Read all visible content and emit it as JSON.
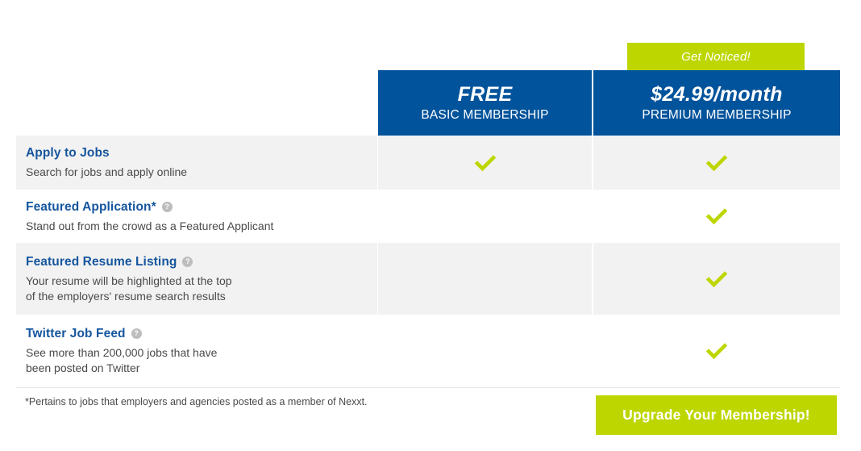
{
  "promo": {
    "label": "Get Noticed!",
    "color": "#bed600"
  },
  "plans": {
    "free": {
      "price": "FREE",
      "name": "BASIC MEMBERSHIP",
      "header_color": "#01539b"
    },
    "premium": {
      "price": "$24.99/month",
      "name": "PREMIUM MEMBERSHIP",
      "header_color": "#01539b"
    }
  },
  "features": [
    {
      "title": "Apply to Jobs",
      "description": "Search for jobs and apply online",
      "help_icon": "",
      "free": "check",
      "premium": "check"
    },
    {
      "title": "Featured Application*",
      "description": "Stand out from the crowd as a Featured Applicant",
      "help_icon": "help-icon",
      "free": "",
      "premium": "check"
    },
    {
      "title": "Featured Resume Listing",
      "description": "Your resume will be highlighted at the top\nof the employers' resume search results",
      "help_icon": "help-icon",
      "free": "",
      "premium": "check"
    },
    {
      "title": "Twitter Job Feed",
      "description": "See more than 200,000 jobs that have\nbeen posted on Twitter",
      "help_icon": "help-icon",
      "free": "",
      "premium": "check"
    }
  ],
  "footer": {
    "footnote": "*Pertains to jobs that employers and agencies posted as a member of Nexxt.",
    "upgrade_label": "Upgrade Your Membership!",
    "upgrade_color": "#bed600"
  },
  "help_glyph": "?",
  "check_color": "#bed600"
}
